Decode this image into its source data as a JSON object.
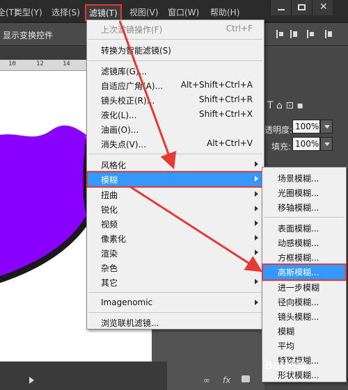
{
  "menubar": {
    "items": [
      "全(T)",
      "类型(Y)",
      "选择(S)",
      "滤镜(T)",
      "视图(V)",
      "窗口(W)",
      "帮助(H)"
    ],
    "window_buttons": [
      "minimize",
      "maximize",
      "close"
    ]
  },
  "options_bar": {
    "label": "显示变换控件"
  },
  "ruler": {
    "ticks": [
      "10",
      "12",
      "14"
    ]
  },
  "right_panel": {
    "opacity_label": "透明度:",
    "opacity_value": "100%",
    "fill_label": "填充:",
    "fill_value": "100%"
  },
  "filter_menu": {
    "items": [
      {
        "label": "上次滤镜操作(F)",
        "shortcut": "Ctrl+F",
        "disabled": true
      },
      {
        "label": "转换为智能滤镜(S)"
      },
      {
        "label": "滤镜库(G)..."
      },
      {
        "label": "自适应广角(A)...",
        "shortcut": "Alt+Shift+Ctrl+A"
      },
      {
        "label": "镜头校正(R)...",
        "shortcut": "Shift+Ctrl+R"
      },
      {
        "label": "液化(L)...",
        "shortcut": "Shift+Ctrl+X"
      },
      {
        "label": "油画(O)..."
      },
      {
        "label": "消失点(V)...",
        "shortcut": "Alt+Ctrl+V"
      },
      {
        "label": "风格化"
      },
      {
        "label": "模糊"
      },
      {
        "label": "扭曲"
      },
      {
        "label": "锐化"
      },
      {
        "label": "视频"
      },
      {
        "label": "像素化"
      },
      {
        "label": "渲染"
      },
      {
        "label": "杂色"
      },
      {
        "label": "其它"
      },
      {
        "label": "Imagenomic"
      },
      {
        "label": "浏览联机滤镜..."
      }
    ]
  },
  "blur_submenu": {
    "items": [
      {
        "label": "场景模糊..."
      },
      {
        "label": "光圈模糊..."
      },
      {
        "label": "移轴模糊..."
      },
      {
        "label": "表面模糊..."
      },
      {
        "label": "动感模糊..."
      },
      {
        "label": "方框模糊..."
      },
      {
        "label": "高斯模糊..."
      },
      {
        "label": "进一步模糊"
      },
      {
        "label": "径向模糊..."
      },
      {
        "label": "镜头模糊..."
      },
      {
        "label": "模糊"
      },
      {
        "label": "平均"
      },
      {
        "label": "特殊模糊..."
      },
      {
        "label": "形状模糊..."
      }
    ]
  },
  "watermark": "Bai经验",
  "colors": {
    "purple_shape": "#8a00ff",
    "highlight": "#3399ff",
    "annotation": "#e53935"
  }
}
